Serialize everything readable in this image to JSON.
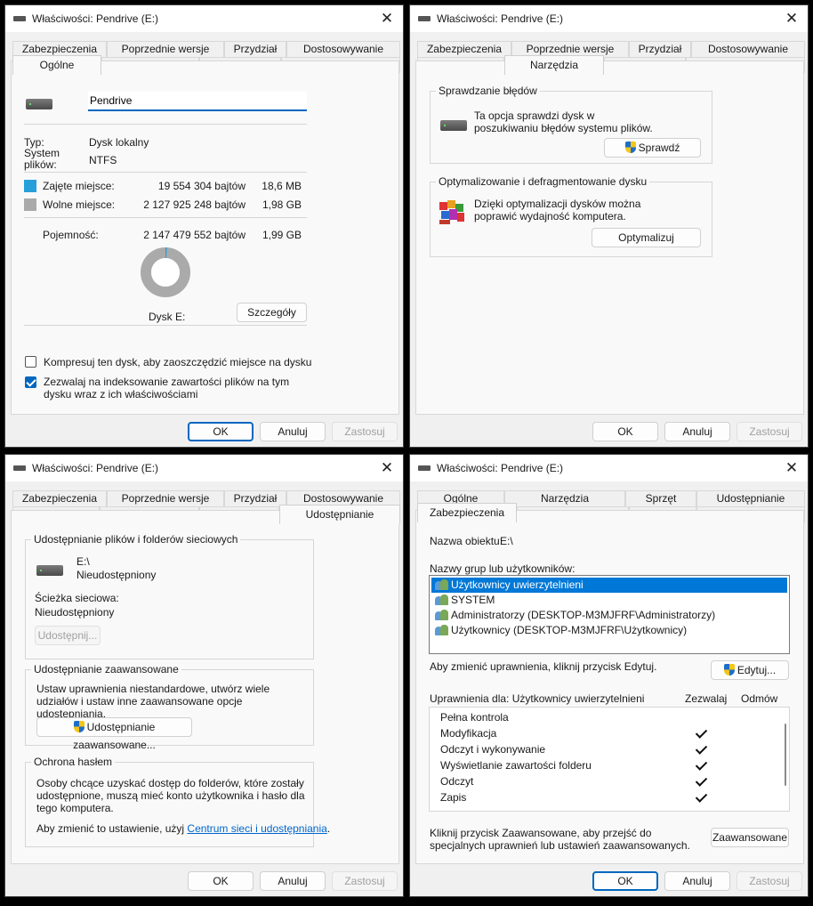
{
  "window_title": "Właściwości: Pendrive (E:)",
  "close_glyph": "✕",
  "tabs": {
    "zabezpieczenia": "Zabezpieczenia",
    "poprzednie": "Poprzednie wersje",
    "przydzial": "Przydział",
    "dostosowywanie": "Dostosowywanie",
    "ogolne": "Ogólne",
    "narzedzia": "Narzędzia",
    "sprzet": "Sprzęt",
    "udostepnianie": "Udostępnianie"
  },
  "buttons": {
    "ok": "OK",
    "anuluj": "Anuluj",
    "zastosuj": "Zastosuj"
  },
  "general": {
    "name_value": "Pendrive",
    "type_label": "Typ:",
    "type_value": "Dysk lokalny",
    "fs_label": "System plików:",
    "fs_value": "NTFS",
    "used_label": "Zajęte miejsce:",
    "used_bytes": "19 554 304 bajtów",
    "used_size": "18,6 MB",
    "free_label": "Wolne miejsce:",
    "free_bytes": "2 127 925 248 bajtów",
    "free_size": "1,98 GB",
    "capacity_label": "Pojemność:",
    "capacity_bytes": "2 147 479 552 bajtów",
    "capacity_size": "1,99 GB",
    "used_fraction": 0.0091,
    "used_color": "#26a0da",
    "free_color": "#aaaaaa",
    "drive_label": "Dysk E:",
    "details_button": "Szczegóły",
    "compress_label": "Kompresuj ten dysk, aby zaoszczędzić miejsce na dysku",
    "compress_checked": false,
    "index_label": "Zezwalaj na indeksowanie zawartości plików na tym dysku wraz z ich właściwościami",
    "index_checked": true
  },
  "tools": {
    "error_group": "Sprawdzanie błędów",
    "error_text": "Ta opcja sprawdzi dysk w poszukiwaniu błędów systemu plików.",
    "check_button": "Sprawdź",
    "opt_group": "Optymalizowanie i defragmentowanie dysku",
    "opt_text": "Dzięki optymalizacji dysków można poprawić wydajność komputera.",
    "optimize_button": "Optymalizuj"
  },
  "sharing": {
    "net_group": "Udostępnianie plików i folderów sieciowych",
    "path": "E:\\",
    "status": "Nieudostępniony",
    "net_path_label": "Ścieżka sieciowa:",
    "net_path_value": "Nieudostępniony",
    "share_button": "Udostępnij...",
    "adv_group": "Udostępnianie zaawansowane",
    "adv_text": "Ustaw uprawnienia niestandardowe, utwórz wiele udziałów i ustaw inne zaawansowane opcje udostępniania.",
    "adv_button": "Udostępnianie zaawansowane...",
    "pwd_group": "Ochrona hasłem",
    "pwd_text": "Osoby chcące uzyskać dostęp do folderów, które zostały udostępnione, muszą mieć konto użytkownika i hasło dla tego komputera.",
    "pwd_change_prefix": "Aby zmienić to ustawienie, użyj ",
    "pwd_link": "Centrum sieci i udostępniania",
    "pwd_change_suffix": "."
  },
  "security": {
    "object_label": "Nazwa obiektu:",
    "object_value": "E:\\",
    "groups_label": "Nazwy grup lub użytkowników:",
    "users": [
      "Użytkownicy uwierzytelnieni",
      "SYSTEM",
      "Administratorzy (DESKTOP-M3MJFRF\\Administratorzy)",
      "Użytkownicy (DESKTOP-M3MJFRF\\Użytkownicy)"
    ],
    "change_text": "Aby zmienić uprawnienia, kliknij przycisk Edytuj.",
    "edit_button": "Edytuj...",
    "perm_for": "Uprawnienia dla: Użytkownicy uwierzytelnieni",
    "allow_header": "Zezwalaj",
    "deny_header": "Odmów",
    "permissions": [
      {
        "name": "Pełna kontrola",
        "allow": false
      },
      {
        "name": "Modyfikacja",
        "allow": true
      },
      {
        "name": "Odczyt i wykonywanie",
        "allow": true
      },
      {
        "name": "Wyświetlanie zawartości folderu",
        "allow": true
      },
      {
        "name": "Odczyt",
        "allow": true
      },
      {
        "name": "Zapis",
        "allow": true
      }
    ],
    "advanced_text": "Kliknij przycisk Zaawansowane, aby przejść do specjalnych uprawnień lub ustawień zaawansowanych.",
    "advanced_button": "Zaawansowane"
  }
}
